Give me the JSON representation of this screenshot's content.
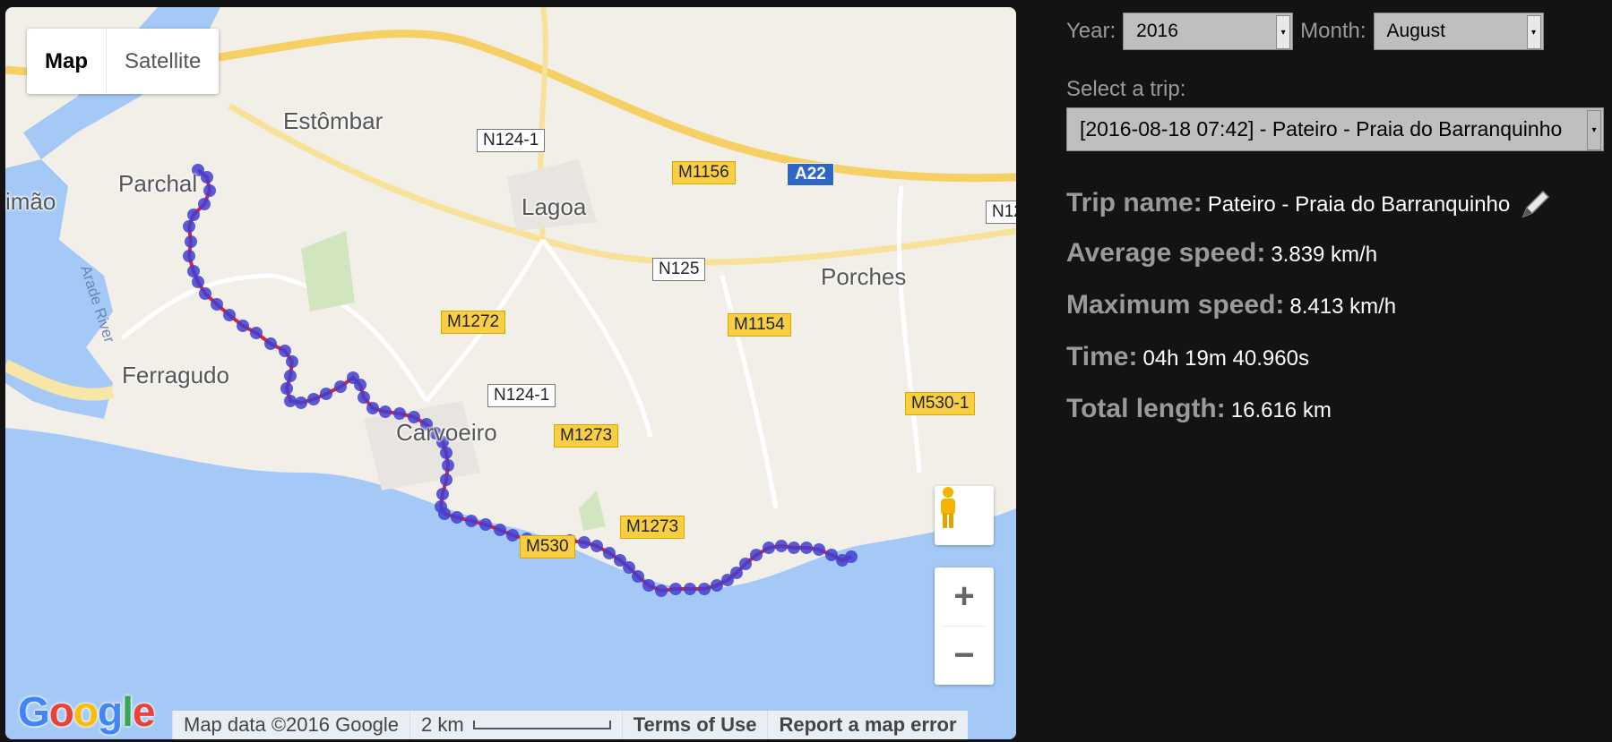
{
  "map": {
    "map_type_buttons": [
      "Map",
      "Satellite"
    ],
    "places": [
      "Estômbar",
      "Parchal",
      "imão",
      "Lagoa",
      "Porches",
      "Ferragudo",
      "Carvoeiro"
    ],
    "river_label": "Arade River",
    "road_labels_white": [
      "N124-1",
      "N125",
      "N124-1",
      "N12"
    ],
    "road_labels_yellow": [
      "M1156",
      "M1272",
      "M1154",
      "M1273",
      "M1273",
      "M530-1",
      "M530"
    ],
    "highway_label": "A22",
    "zoom_in": "+",
    "zoom_out": "−",
    "google_logo": "Google",
    "attribution": {
      "map_data": "Map data ©2016 Google",
      "scale": "2 km",
      "terms": "Terms of Use",
      "report": "Report a map error"
    },
    "colors": {
      "water": "#a5c9f7",
      "land": "#f2efe9",
      "track_line": "#e5202a",
      "track_point": "#3f3fd2"
    }
  },
  "panel": {
    "year_label": "Year:",
    "year_value": "2016",
    "month_label": "Month:",
    "month_value": "August",
    "trip_label": "Select a trip:",
    "trip_value": "[2016-08-18 07:42] - Pateiro - Praia do Barranquinho",
    "trip_name_label": "Trip name:",
    "trip_name_value": "Pateiro - Praia do Barranquinho",
    "avg_speed_label": "Average speed:",
    "avg_speed_value": "3.839 km/h",
    "max_speed_label": "Maximum speed:",
    "max_speed_value": "8.413 km/h",
    "time_label": "Time:",
    "time_value": "04h 19m 40.960s",
    "length_label": "Total length:",
    "length_value": "16.616 km"
  }
}
